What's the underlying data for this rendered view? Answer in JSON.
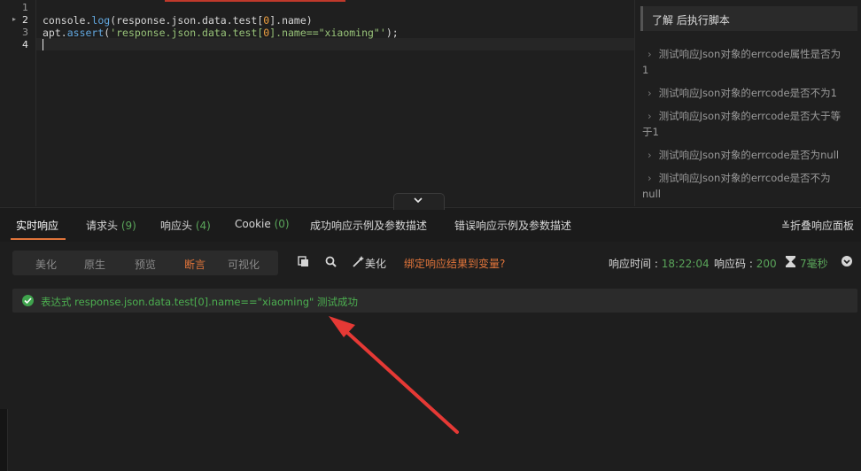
{
  "editor": {
    "line_numbers": [
      "1",
      "2",
      "3",
      "4"
    ],
    "line1": {
      "obj": "console",
      "dot": ".",
      "fn": "log",
      "rest": "(response.json.data.test[",
      "idx": "0",
      "tail": "].name)"
    },
    "line2": {
      "obj": "apt",
      "dot": ".",
      "fn": "assert",
      "open": "(",
      "str1": "'response.json.data.test[",
      "idx": "0",
      "str2": "].name==",
      "str3": "\"xiaoming\"",
      "str4": "'",
      "close": ");"
    }
  },
  "help_panel": {
    "title": "了解 后执行脚本",
    "items": [
      {
        "line1": "测试响应Json对象的errcode属性是否为",
        "line2": "1"
      },
      {
        "line1": "测试响应Json对象的errcode是否不为1",
        "line2": ""
      },
      {
        "line1": "测试响应Json对象的errcode是否大于等",
        "line2": "于1"
      },
      {
        "line1": "测试响应Json对象的errcode是否为null",
        "line2": ""
      },
      {
        "line1": "测试响应Json对象的errcode是否不为",
        "line2": "null"
      }
    ]
  },
  "tabs": {
    "realtime": "实时响应",
    "req_headers": "请求头",
    "req_headers_count": "(9)",
    "resp_headers": "响应头",
    "resp_headers_count": "(4)",
    "cookie": "Cookie",
    "cookie_count": "(0)",
    "success_example": "成功响应示例及参数描述",
    "error_example": "错误响应示例及参数描述",
    "fold_panel": "折叠响应面板"
  },
  "toolbar": {
    "view_modes": [
      "美化",
      "原生",
      "预览",
      "断言",
      "可视化"
    ],
    "active_mode": "断言",
    "beautify": "美化",
    "bind_variable": "绑定响应结果到变量?",
    "resp_time_label": "响应时间 : ",
    "resp_time": "18:22:04",
    "resp_code_label": "响应码 : ",
    "resp_code": "200",
    "duration": "7毫秒"
  },
  "result": {
    "message": "表达式 response.json.data.test[0].name==\"xiaoming\" 测试成功"
  },
  "colors": {
    "accent": "#e0743a",
    "success": "#4caf50",
    "annotation_arrow": "#e53935"
  },
  "icons": [
    "chevron-down-icon",
    "copy-icon",
    "search-icon",
    "magic-wand-icon",
    "hourglass-icon",
    "download-icon",
    "check-circle-icon",
    "chevron-right-icon"
  ]
}
